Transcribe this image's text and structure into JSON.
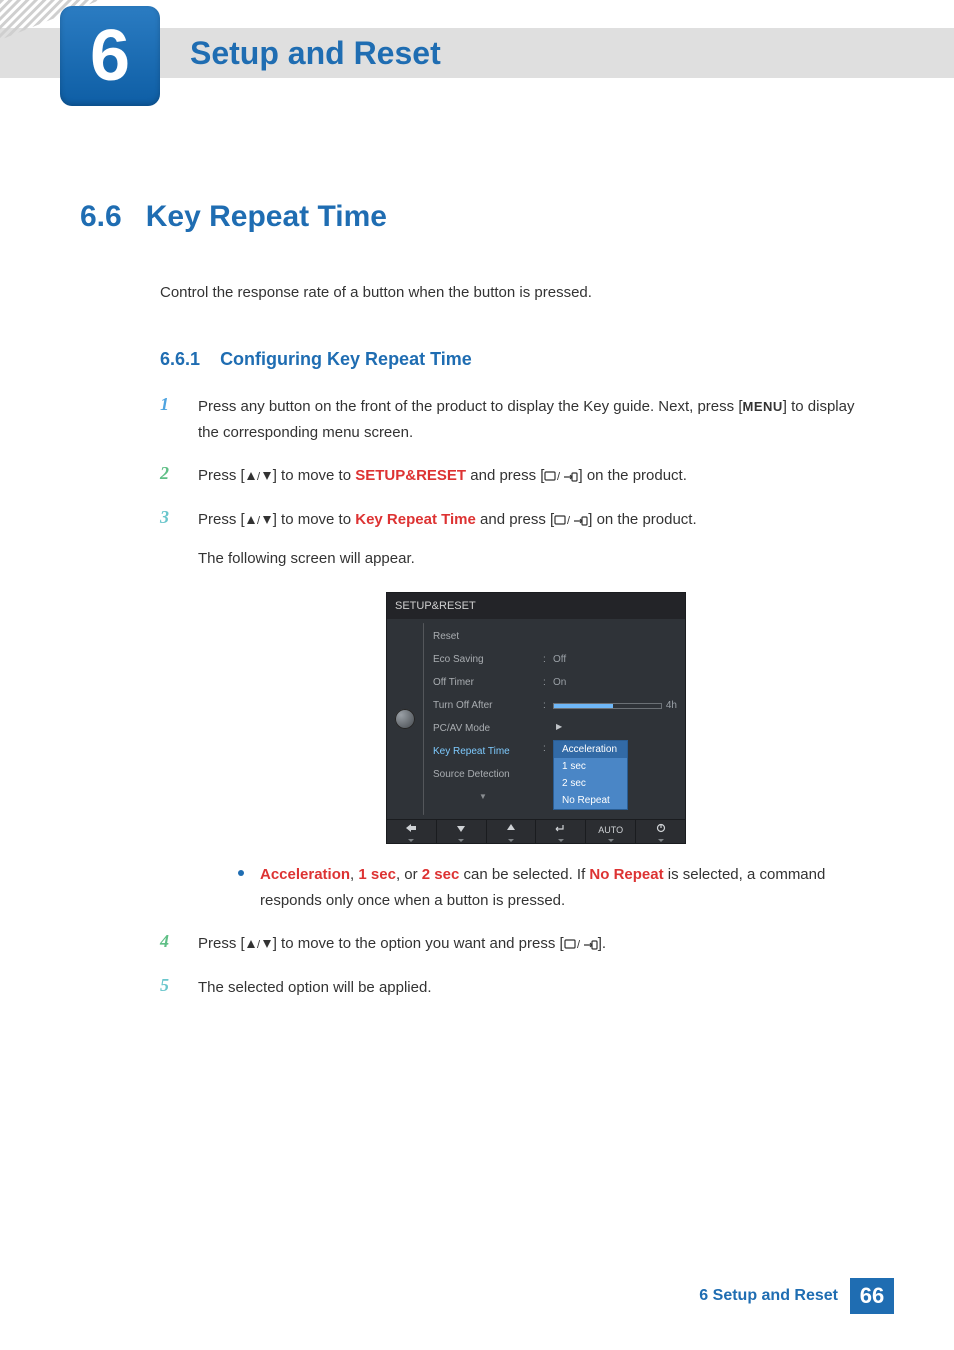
{
  "chapter": {
    "number": "6",
    "title": "Setup and Reset"
  },
  "section": {
    "number": "6.6",
    "title": "Key Repeat Time"
  },
  "intro": "Control the response rate of a button when the button is pressed.",
  "subsection": {
    "number": "6.6.1",
    "title": "Configuring Key Repeat Time"
  },
  "steps": {
    "s1": {
      "num": "1",
      "t1": "Press any button on the front of the product to display the Key guide. Next, press [",
      "menu": "MENU",
      "t2": "] to display the corresponding menu screen."
    },
    "s2": {
      "num": "2",
      "t1": "Press [",
      "t2": "] to move to ",
      "red": "SETUP&RESET",
      "t3": " and press [",
      "t4": "] on the product."
    },
    "s3": {
      "num": "3",
      "t1": "Press [",
      "t2": "] to move to ",
      "red": "Key Repeat Time",
      "t3": " and press [",
      "t4": "] on the product.",
      "follow": "The following screen will appear."
    },
    "s4": {
      "num": "4",
      "t1": "Press [",
      "t2": "] to move to the option you want and press [",
      "t3": "]."
    },
    "s5": {
      "num": "5",
      "text": "The selected option will be applied."
    }
  },
  "bullet": {
    "r1": "Acceleration",
    "sep1": ", ",
    "r2": "1 sec",
    "sep2": ", or ",
    "r3": "2 sec",
    "mid": " can be selected. If ",
    "r4": "No Repeat",
    "tail": " is selected, a command responds only once when a button is pressed."
  },
  "osd": {
    "title": "SETUP&RESET",
    "items": [
      "Reset",
      "Eco Saving",
      "Off Timer",
      "Turn Off After",
      "PC/AV Mode",
      "Key Repeat Time",
      "Source Detection"
    ],
    "values": {
      "eco": "Off",
      "offtimer": "On",
      "turnoff": "4h"
    },
    "popup": [
      "Acceleration",
      "1 sec",
      "2 sec",
      "No Repeat"
    ],
    "footer_auto": "AUTO"
  },
  "footer": {
    "label": "6 Setup and Reset",
    "page": "66"
  }
}
